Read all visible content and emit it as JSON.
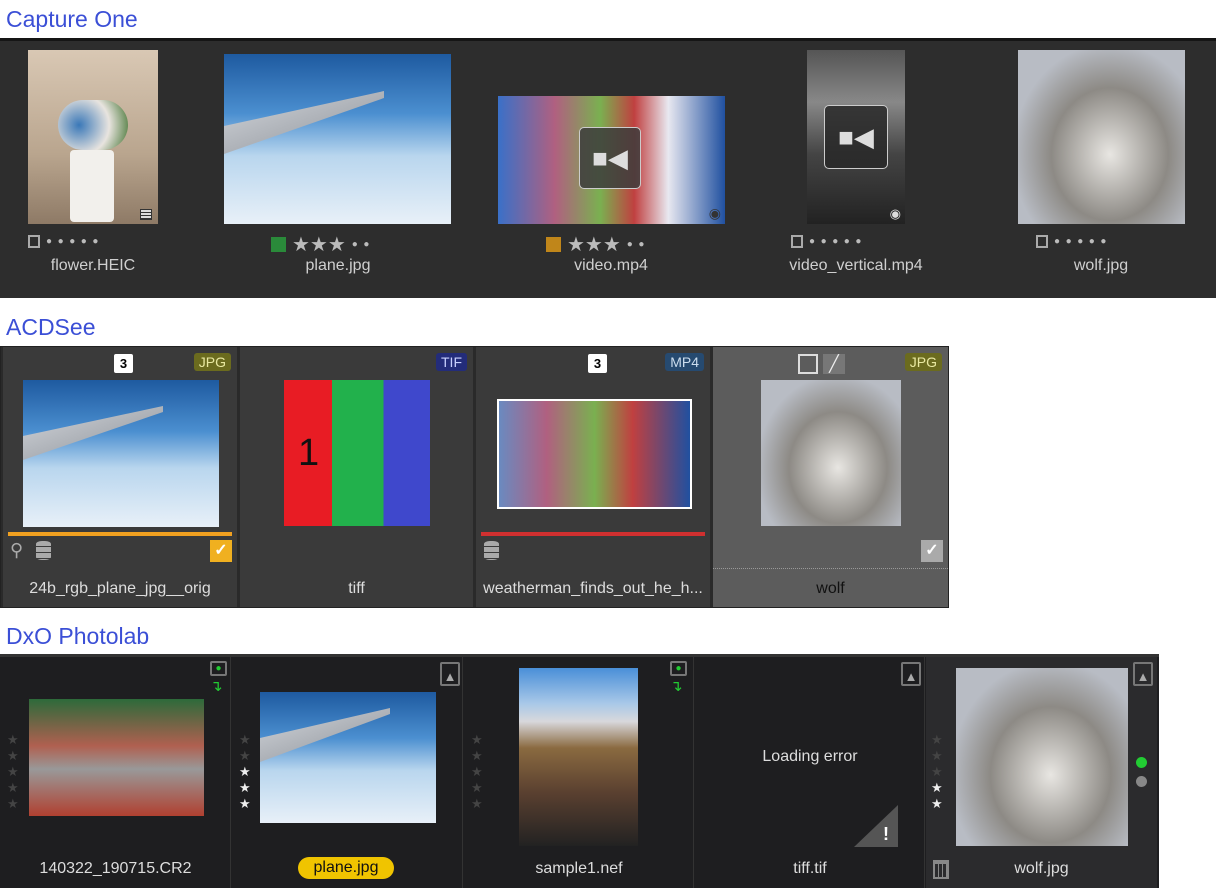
{
  "sections": {
    "capture_one": "Capture One",
    "acdsee": "ACDSee",
    "dxo": "DxO Photolab"
  },
  "capture_one": {
    "items": [
      {
        "name": "flower.HEIC",
        "rating": 0,
        "color": null
      },
      {
        "name": "plane.jpg",
        "rating": 3,
        "color": "#2a8a3a"
      },
      {
        "name": "video.mp4",
        "rating": 3,
        "color": "#c0861a"
      },
      {
        "name": "video_vertical.mp4",
        "rating": 0,
        "color": null
      },
      {
        "name": "wolf.jpg",
        "rating": 0,
        "color": null
      }
    ]
  },
  "acdsee": {
    "items": [
      {
        "name": "24b_rgb_plane_jpg__orig",
        "badge": "JPG",
        "count": "3",
        "bar_color": "#f0a020"
      },
      {
        "name": "tiff",
        "badge": "TIF",
        "page_number": "1"
      },
      {
        "name": "weatherman_finds_out_he_h...",
        "badge": "MP4",
        "count": "3",
        "bar_color": "#d03030"
      },
      {
        "name": "wolf",
        "badge": "JPG"
      }
    ]
  },
  "dxo": {
    "items": [
      {
        "name": "140322_190715.CR2",
        "rating": 0
      },
      {
        "name": "plane.jpg",
        "rating": 3
      },
      {
        "name": "sample1.nef",
        "rating": 0
      },
      {
        "name": "tiff.tif",
        "error": "Loading error"
      },
      {
        "name": "wolf.jpg",
        "rating": 2
      }
    ]
  }
}
